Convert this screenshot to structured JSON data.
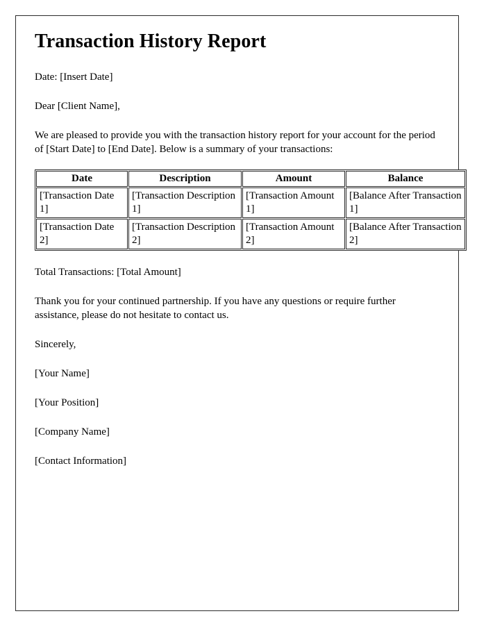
{
  "document": {
    "title": "Transaction History Report",
    "date_line": "Date: [Insert Date]",
    "salutation": "Dear [Client Name],",
    "intro": "We are pleased to provide you with the transaction history report for your account for the period of [Start Date] to [End Date]. Below is a summary of your transactions:",
    "total_line": "Total Transactions: [Total Amount]",
    "closing": "Thank you for your continued partnership. If you have any questions or require further assistance, please do not hesitate to contact us.",
    "signoff": "Sincerely,",
    "signature_block": [
      "[Your Name]",
      "[Your Position]",
      "[Company Name]",
      "[Contact Information]"
    ]
  },
  "table": {
    "headers": [
      "Date",
      "Description",
      "Amount",
      "Balance"
    ],
    "rows": [
      {
        "date": "[Transaction Date 1]",
        "description": "[Transaction Description 1]",
        "amount": "[Transaction Amount 1]",
        "balance": "[Balance After Transaction 1]"
      },
      {
        "date": "[Transaction Date 2]",
        "description": "[Transaction Description 2]",
        "amount": "[Transaction Amount 2]",
        "balance": "[Balance After Transaction 2]"
      }
    ]
  },
  "style": {
    "page_border_color": "#2b2b2b",
    "text_color": "#000000",
    "background_color": "#ffffff"
  }
}
